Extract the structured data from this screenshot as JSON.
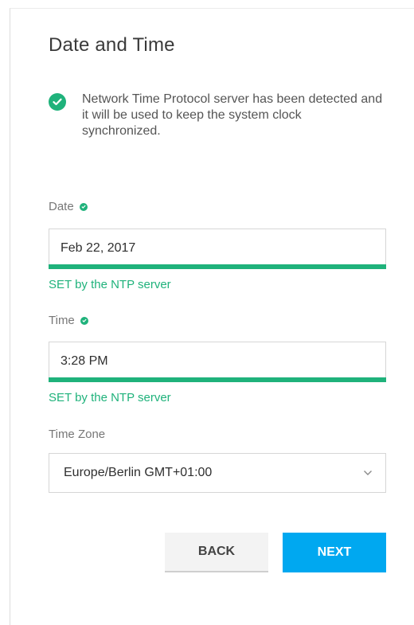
{
  "title": "Date and Time",
  "notice": {
    "icon": "check-circle-icon",
    "text": "Network Time Protocol server has been detected and it will be used to keep the system clock synchronized."
  },
  "date": {
    "label": "Date",
    "value": "Feb 22, 2017",
    "status": "SET by the NTP server"
  },
  "time": {
    "label": "Time",
    "value": "3:28 PM",
    "status": "SET by the NTP server"
  },
  "timezone": {
    "label": "Time Zone",
    "value": "Europe/Berlin GMT+01:00"
  },
  "buttons": {
    "back": "BACK",
    "next": "NEXT"
  },
  "colors": {
    "accent_green": "#1fb27b",
    "primary_blue": "#00a8f0",
    "back_button_bg": "#f3f3f3"
  }
}
